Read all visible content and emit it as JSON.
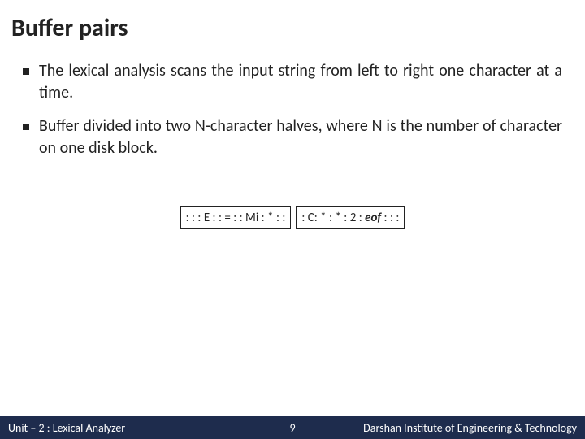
{
  "title": "Buffer pairs",
  "bullets": [
    "The lexical analysis scans the input string from left to right one character at a time.",
    "Buffer divided into two N-character halves, where N is the number of character on one disk block."
  ],
  "buffer": {
    "left": ": : : E : : = : : Mi : * : :",
    "right_prefix": ": C: * : * : 2 : ",
    "right_eof": "eof",
    "right_suffix": " : : :"
  },
  "footer": {
    "left": "Unit – 2 : Lexical Analyzer",
    "page": "9",
    "right": "Darshan Institute of Engineering & Technology"
  }
}
